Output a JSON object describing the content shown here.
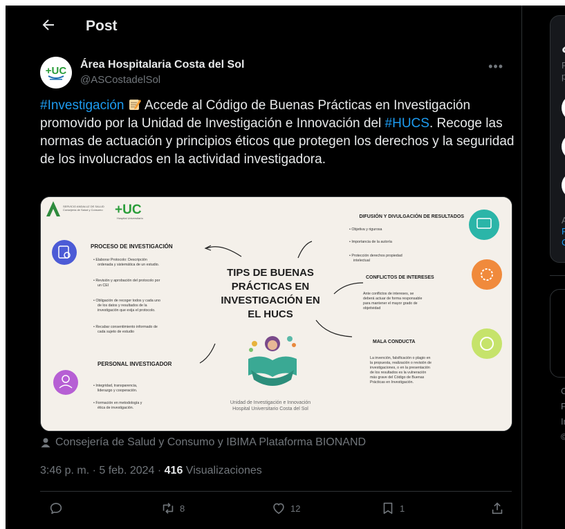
{
  "header": {
    "title": "Post"
  },
  "author": {
    "name": "Área Hospitalaria Costa del Sol",
    "handle": "@ASCostadelSol",
    "logo_text": "+UC"
  },
  "tweet": {
    "tag1": "#Investigación",
    "text1": " Accede al Código de Buenas Prácticas en Investigación promovido por la Unidad de Investigación e Innovación  del ",
    "tag2": "#HUCS",
    "text2": ". Recoge las normas de actuación y principios éticos que protegen los derechos y la seguridad de los involucrados en la actividad investigadora."
  },
  "infographic": {
    "title": "TIPS DE BUENAS PRÁCTICAS EN INVESTIGACIÓN EN EL HUCS",
    "footer1": "Unidad de Investigación e Innovación",
    "footer2": "Hospital Universitario Costa del Sol",
    "sections": {
      "proceso": {
        "title": "PROCESO DE INVESTIGACIÓN",
        "items": [
          "Elaborar Protocolo: Descripción ordenada y sistemática de un estudio.",
          "Revisión y aprobación del protocolo por un CEI",
          "Obligación de recoger todos y cada uno de los datos y resultados de la investigación que exija el protocolo.",
          "Recabar consentimiento informado de cada sujeto de estudio"
        ]
      },
      "personal": {
        "title": "PERSONAL INVESTIGADOR",
        "items": [
          "Integridad, transparencia, liderazgo y cooperación.",
          "Formación en metodología y ética de investigación."
        ]
      },
      "difusion": {
        "title": "DIFUSIÓN Y DIVULGACIÓN DE RESULTADOS",
        "items": [
          "Objetiva y rigurosa",
          "Importancia de la autoría",
          "Protección derechos propiedad intelectual"
        ]
      },
      "conflictos": {
        "title": "CONFLICTOS DE INTERESES",
        "text": "Ante conflictos de intereses, se deberá actuar de forma responsable para mantener el mayor grado de objetividad"
      },
      "mala": {
        "title": "MALA CONDUCTA",
        "text": "La invención, falsificación o plagio en la propuesta, realización o revisión de investigaciones, o en la presentación de los resultados es la vulneración más grave del Código de Buenas Prácticas en Investigación."
      }
    }
  },
  "credit": "Consejería de Salud y Consumo y IBIMA Plataforma BIONAND",
  "meta": {
    "time": "3:46 p. m. · 5 feb. 2024 · ",
    "views": "416",
    "views_label": " Visualizaciones"
  },
  "actions": {
    "retweets": "8",
    "likes": "12",
    "bookmarks": "1"
  },
  "right": {
    "big": "¿",
    "t1": "Re",
    "t2": "pe",
    "t3": "Al",
    "l1": "Po",
    "l2": "Co",
    "f1": "C",
    "f2": "P",
    "f3": "In",
    "f4": "©"
  },
  "colors": {
    "accent": "#1d9bf0",
    "bg": "#000000",
    "muted": "#71767b",
    "text": "#e7e9ea"
  }
}
